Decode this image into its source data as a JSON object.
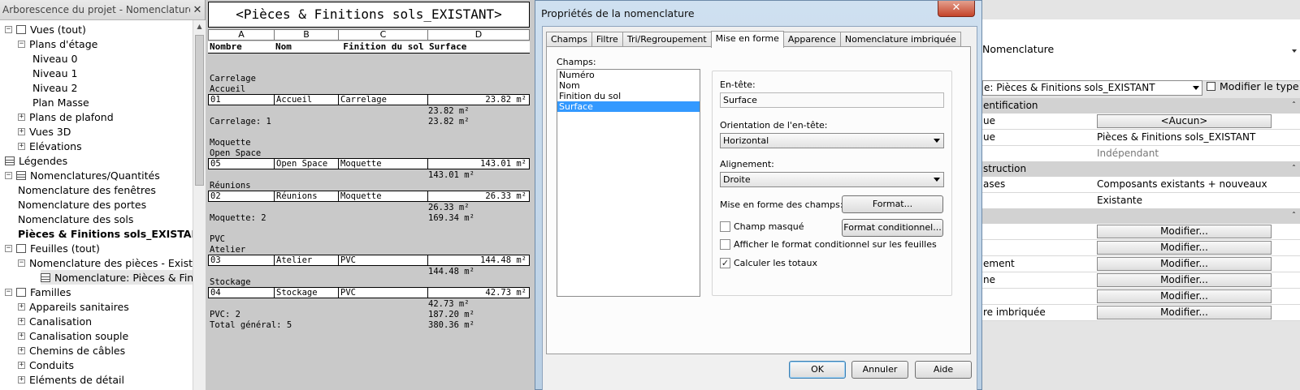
{
  "browser": {
    "title": "Arborescence du projet - Nomenclatures Piè...",
    "close": "✕",
    "nodes": [
      {
        "label": "Vues (tout)",
        "exp": "−",
        "icon": "views"
      },
      {
        "label": "Plans d'étage",
        "exp": "−"
      },
      {
        "label": "Niveau 0"
      },
      {
        "label": "Niveau 1"
      },
      {
        "label": "Niveau 2"
      },
      {
        "label": "Plan Masse"
      },
      {
        "label": "Plans de plafond",
        "exp": "+"
      },
      {
        "label": "Vues 3D",
        "exp": "+"
      },
      {
        "label": "Elévations",
        "exp": "+"
      },
      {
        "label": "Légendes",
        "icon": "legend"
      },
      {
        "label": "Nomenclatures/Quantités",
        "exp": "−",
        "icon": "schedule"
      },
      {
        "label": "Nomenclature des fenêtres"
      },
      {
        "label": "Nomenclature des portes"
      },
      {
        "label": "Nomenclature des sols"
      },
      {
        "label": "Pièces & Finitions sols_EXISTANT"
      },
      {
        "label": "Feuilles (tout)",
        "exp": "−",
        "icon": "sheets"
      },
      {
        "label": "Nomenclature des pièces - Existant",
        "exp": "−"
      },
      {
        "label": "Nomenclature: Pièces & Finitio",
        "icon": "schedule"
      },
      {
        "label": "Familles",
        "exp": "−",
        "icon": "families"
      },
      {
        "label": "Appareils sanitaires",
        "exp": "+"
      },
      {
        "label": "Canalisation",
        "exp": "+"
      },
      {
        "label": "Canalisation souple",
        "exp": "+"
      },
      {
        "label": "Chemins de câbles",
        "exp": "+"
      },
      {
        "label": "Conduits",
        "exp": "+"
      },
      {
        "label": "Eléments de détail",
        "exp": "+"
      }
    ]
  },
  "schedule": {
    "title": "<Pièces & Finitions sols_EXISTANT>",
    "letters": [
      "A",
      "B",
      "C",
      "D"
    ],
    "headers": [
      "Nombre",
      "Nom",
      "Finition du sol",
      "Surface"
    ],
    "lines": {
      "carrelage": "Carrelage",
      "accueil": "Accueil",
      "carrelage_count": "Carrelage: 1",
      "moquette": "Moquette",
      "open_space": "Open Space",
      "reunions": "Réunions",
      "moquette_count": "Moquette: 2",
      "pvc": "PVC",
      "atelier": "Atelier",
      "stockage": "Stockage",
      "pvc_count": "PVC: 2",
      "total": "Total général: 5"
    },
    "rows": [
      {
        "num": "01",
        "nom": "Accueil",
        "finition": "Carrelage",
        "surface": "23.82 m²"
      },
      {
        "num": "05",
        "nom": "Open Space",
        "finition": "Moquette",
        "surface": "143.01 m²"
      },
      {
        "num": "02",
        "nom": "Réunions",
        "finition": "Moquette",
        "surface": "26.33 m²"
      },
      {
        "num": "03",
        "nom": "Atelier",
        "finition": "PVC",
        "surface": "144.48 m²"
      },
      {
        "num": "04",
        "nom": "Stockage",
        "finition": "PVC",
        "surface": "42.73 m²"
      }
    ],
    "subtotals": {
      "s1": "23.82 m²",
      "s2": "23.82 m²",
      "s3": "143.01 m²",
      "s4": "26.33 m²",
      "s5": "169.34 m²",
      "s6": "144.48 m²",
      "s7": "42.73 m²",
      "s8": "187.20 m²",
      "s9": "380.36 m²"
    }
  },
  "dialog": {
    "title": "Propriétés de la nomenclature",
    "close": "✕",
    "tabs": [
      "Champs",
      "Filtre",
      "Tri/Regroupement",
      "Mise en forme",
      "Apparence",
      "Nomenclature imbriquée"
    ],
    "active_tab": "Mise en forme",
    "fields_label": "Champs:",
    "fields": [
      "Numéro",
      "Nom",
      "Finition du sol",
      "Surface"
    ],
    "selected_field": "Surface",
    "header_label": "En-tête:",
    "header_value": "Surface",
    "orientation_label": "Orientation de l'en-tête:",
    "orientation_value": "Horizontal",
    "alignment_label": "Alignement:",
    "alignment_value": "Droite",
    "format_label": "Mise en forme des champs:",
    "format_button": "Format...",
    "conditional_button": "Format conditionnel...",
    "hidden_field": {
      "label": "Champ masqué",
      "checked": false
    },
    "show_conditional": {
      "label": "Afficher le format conditionnel sur les feuilles",
      "checked": false
    },
    "calc_totals": {
      "label": "Calculer les totaux",
      "checked": true
    },
    "ok": "OK",
    "cancel": "Annuler",
    "help": "Aide"
  },
  "props": {
    "type_name": "Nomenclature",
    "instance": "e: Pièces & Finitions sols_EXISTANT",
    "edit_type": "Modifier le type",
    "sections": {
      "ident": "entification",
      "phase": "struction",
      "other": ""
    },
    "rows": {
      "r1": {
        "name": "ue",
        "value": "<Aucun>"
      },
      "r2": {
        "name": "ue",
        "value": "Pièces & Finitions sols_EXISTANT"
      },
      "r3": {
        "name": "",
        "value": "Indépendant"
      },
      "r4": {
        "name": "ases",
        "value": "Composants existants + nouveaux"
      },
      "r5": {
        "name": "",
        "value": "Existante"
      },
      "r6": {
        "name": "",
        "value": "Modifier..."
      },
      "r7": {
        "name": "",
        "value": "Modifier..."
      },
      "r8": {
        "name": "ement",
        "value": "Modifier..."
      },
      "r9": {
        "name": "ne",
        "value": "Modifier..."
      },
      "r10": {
        "name": "",
        "value": "Modifier..."
      },
      "r11": {
        "name": "re imbriquée",
        "value": "Modifier..."
      }
    },
    "collapse": "ˆ"
  }
}
